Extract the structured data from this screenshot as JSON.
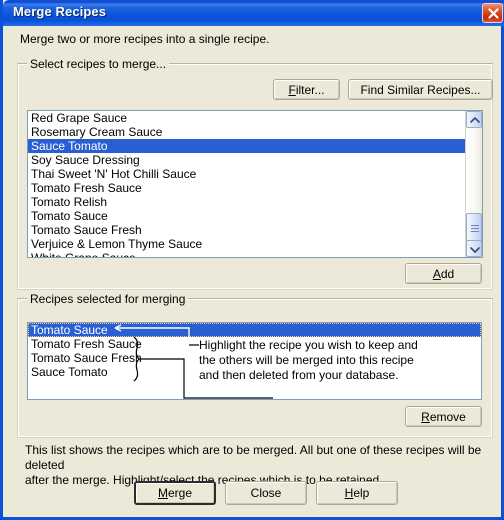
{
  "window": {
    "title": "Merge Recipes",
    "close_icon": "close-icon",
    "intro": "Merge two or more recipes into a single recipe."
  },
  "select_group": {
    "label": "Select recipes to merge...",
    "filter_button": "Filter...",
    "filter_accel": "F",
    "find_similar_button": "Find Similar Recipes...",
    "add_button": "Add",
    "add_accel": "A",
    "items": [
      "Red Grape Sauce",
      "Rosemary Cream Sauce",
      "Sauce Tomato",
      "Soy Sauce Dressing",
      "Thai Sweet 'N' Hot Chilli Sauce",
      "Tomato Fresh Sauce",
      "Tomato Relish",
      "Tomato Sauce",
      "Tomato Sauce Fresh",
      "Verjuice & Lemon Thyme Sauce",
      "White Grape Sauce"
    ],
    "selected_index": 2,
    "scrollbar": {
      "up_icon": "chevron-up-icon",
      "down_icon": "chevron-down-icon",
      "thumb_icon": "scroll-thumb-grip"
    }
  },
  "merge_group": {
    "label": "Recipes selected for merging",
    "remove_button": "Remove",
    "remove_accel": "R",
    "items": [
      "Tomato Sauce",
      "Tomato Fresh Sauce",
      "Tomato Sauce Fresh",
      "Sauce Tomato"
    ],
    "selected_index": 0,
    "annotation": {
      "line1": "Highlight the recipe you wish to keep and",
      "line2": "the others will be merged into this recipe",
      "line3": "and then deleted from your database."
    }
  },
  "footer": {
    "note_line1": "This list shows the recipes which are to be merged.  All but one of these recipes will be deleted",
    "note_line2": "after the merge.  Highlight/select the recipes which is to be retained.",
    "merge_button": "Merge",
    "merge_accel": "M",
    "close_button": "Close",
    "help_button": "Help",
    "help_accel": "H"
  },
  "colors": {
    "dialog_bg": "#ECE9D8",
    "title_blue": "#0b52d6",
    "selection_blue": "#2a5fd4",
    "close_red": "#c9290b"
  }
}
